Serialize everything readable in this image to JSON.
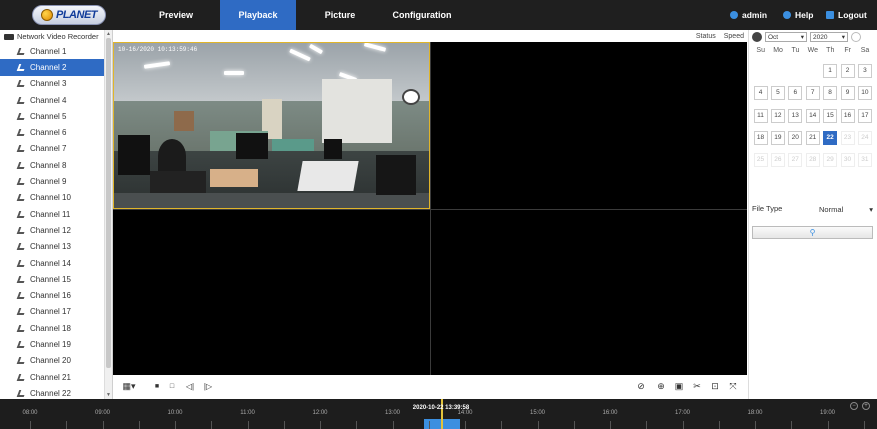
{
  "app": {
    "logo_text": "PLANET"
  },
  "nav": {
    "tabs": [
      {
        "label": "Preview"
      },
      {
        "label": "Playback"
      },
      {
        "label": "Picture"
      },
      {
        "label": "Configuration"
      }
    ],
    "active_index": 1,
    "user": "admin",
    "help": "Help",
    "logout": "Logout"
  },
  "sidebar": {
    "root_label": "Network Video Recorder",
    "selected_index": 1,
    "channels": [
      "Channel 1",
      "Channel 2",
      "Channel 3",
      "Channel 4",
      "Channel 5",
      "Channel 6",
      "Channel 7",
      "Channel 8",
      "Channel 9",
      "Channel 10",
      "Channel 11",
      "Channel 12",
      "Channel 13",
      "Channel 14",
      "Channel 15",
      "Channel 16",
      "Channel 17",
      "Channel 18",
      "Channel 19",
      "Channel 20",
      "Channel 21",
      "Channel 22"
    ]
  },
  "player": {
    "status_label": "Status",
    "speed_label": "Speed",
    "timestamp": "10-16/2020  10:13:59:46"
  },
  "calendar": {
    "month": "Oct",
    "year": "2020",
    "weekdays": [
      "Su",
      "Mo",
      "Tu",
      "We",
      "Th",
      "Fr",
      "Sa"
    ],
    "first_weekday": 4,
    "days_in_month": 31,
    "selected_day": 22,
    "last_enabled_day": 22
  },
  "search": {
    "file_type_label": "File Type",
    "file_type_value": "Normal"
  },
  "timeline": {
    "labels": [
      "08:00",
      "09:00",
      "10:00",
      "11:00",
      "12:00",
      "13:00",
      "14:00",
      "15:00",
      "16:00",
      "17:00",
      "18:00",
      "19:00"
    ],
    "current": "2020-10-22 13:39:58"
  },
  "colors": {
    "accent": "#2f6bc4",
    "topbar": "#1f1f1f",
    "selection_border": "#e0b52a"
  },
  "icons": {
    "split": "split-screen-icon",
    "stop": "stop-icon",
    "pause": "pause-icon",
    "slow": "slow-icon",
    "fast": "fast-icon",
    "hide": "hide-icon",
    "zoom": "zoom-icon",
    "capture": "capture-icon",
    "clip": "clip-icon",
    "download": "download-icon",
    "fullscreen": "fullscreen-icon"
  }
}
